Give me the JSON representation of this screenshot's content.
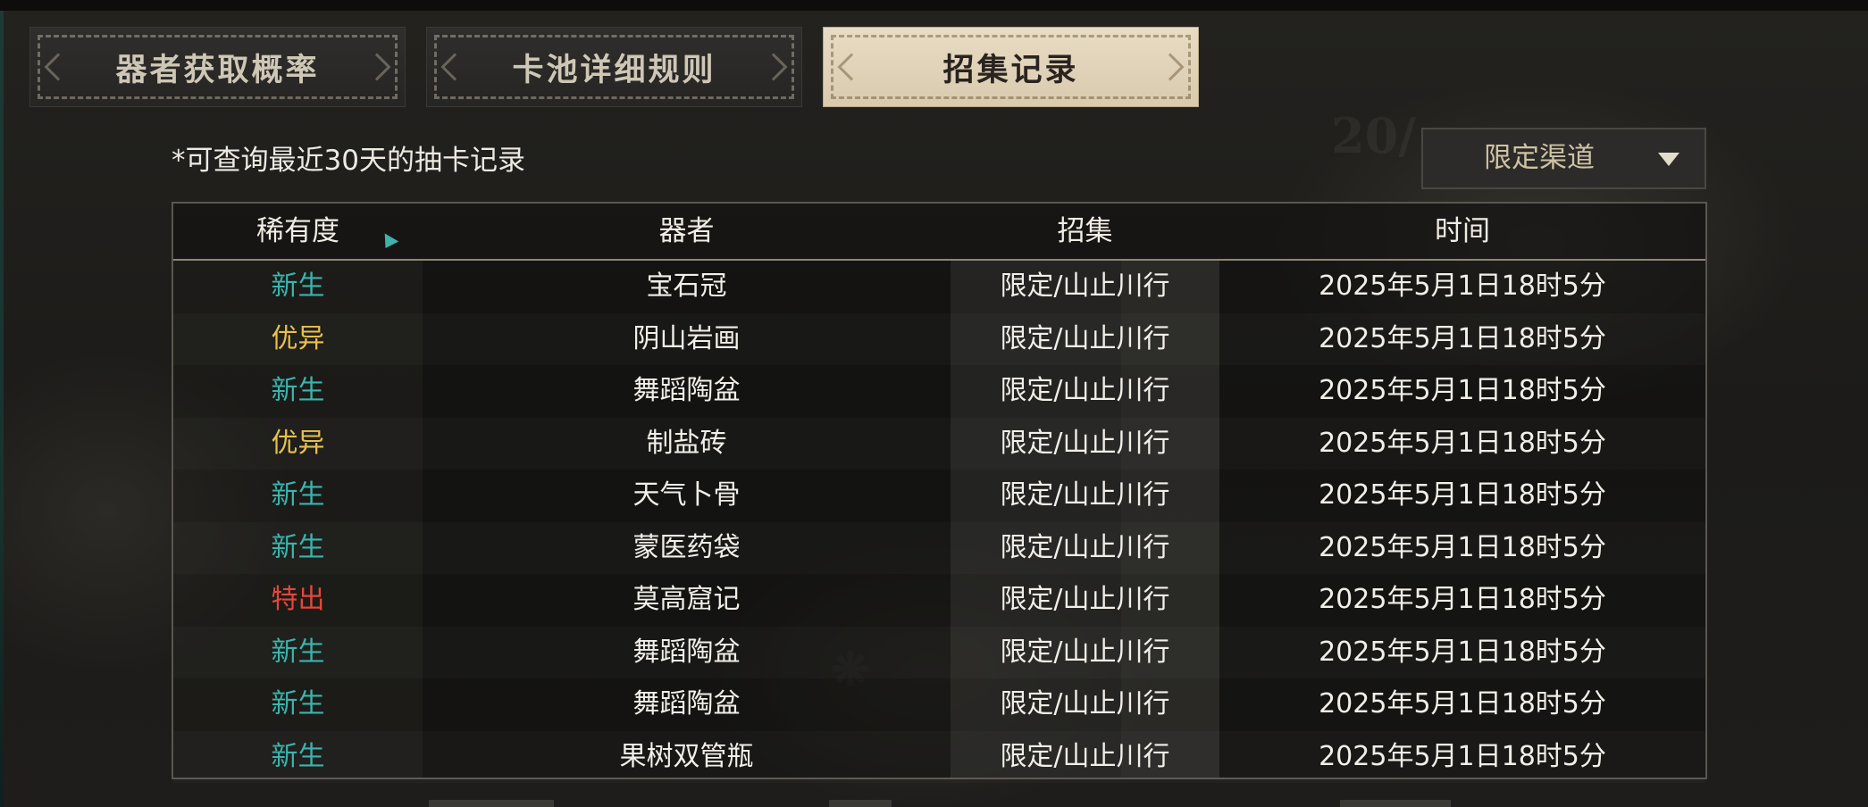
{
  "tabs": [
    {
      "label": "器者获取概率",
      "active": false
    },
    {
      "label": "卡池详细规则",
      "active": false
    },
    {
      "label": "招集记录",
      "active": true
    }
  ],
  "notice": "*可查询最近30天的抽卡记录",
  "filter": {
    "selected": "限定渠道",
    "icon": "caret-down-icon"
  },
  "table": {
    "headers": {
      "rarity": "稀有度",
      "name": "器者",
      "pool": "招集",
      "time": "时间"
    },
    "rows": [
      {
        "rarity": "新生",
        "name": "宝石冠",
        "pool": "限定/山止川行",
        "time": "2025年5月1日18时5分"
      },
      {
        "rarity": "优异",
        "name": "阴山岩画",
        "pool": "限定/山止川行",
        "time": "2025年5月1日18时5分"
      },
      {
        "rarity": "新生",
        "name": "舞蹈陶盆",
        "pool": "限定/山止川行",
        "time": "2025年5月1日18时5分"
      },
      {
        "rarity": "优异",
        "name": "制盐砖",
        "pool": "限定/山止川行",
        "time": "2025年5月1日18时5分"
      },
      {
        "rarity": "新生",
        "name": "天气卜骨",
        "pool": "限定/山止川行",
        "time": "2025年5月1日18时5分"
      },
      {
        "rarity": "新生",
        "name": "蒙医药袋",
        "pool": "限定/山止川行",
        "time": "2025年5月1日18时5分"
      },
      {
        "rarity": "特出",
        "name": "莫高窟记",
        "pool": "限定/山止川行",
        "time": "2025年5月1日18时5分"
      },
      {
        "rarity": "新生",
        "name": "舞蹈陶盆",
        "pool": "限定/山止川行",
        "time": "2025年5月1日18时5分"
      },
      {
        "rarity": "新生",
        "name": "舞蹈陶盆",
        "pool": "限定/山止川行",
        "time": "2025年5月1日18时5分"
      },
      {
        "rarity": "新生",
        "name": "果树双管瓶",
        "pool": "限定/山止川行",
        "time": "2025年5月1日18时5分"
      }
    ]
  },
  "rarity_colors": {
    "新生": "#3ab5ad",
    "优异": "#e7c14c",
    "特出": "#e5463c"
  }
}
